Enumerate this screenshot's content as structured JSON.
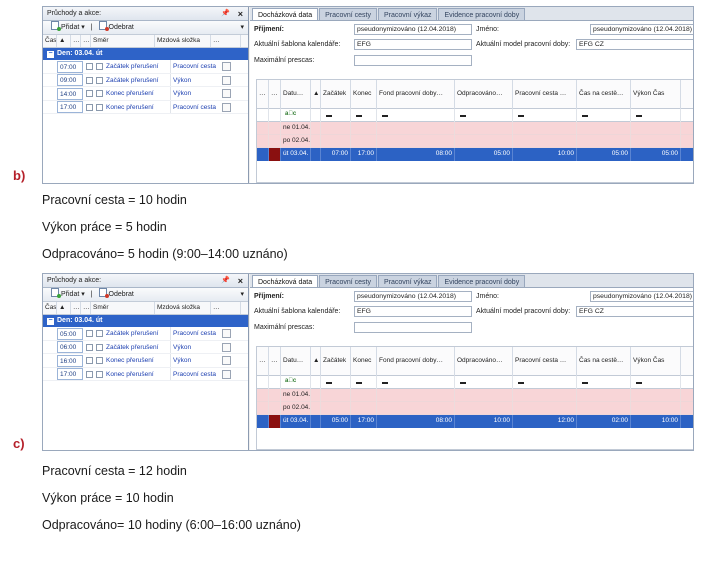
{
  "blocks": [
    {
      "marker": "b)",
      "left_panel": {
        "title": "Průchody a akce:",
        "pin": "📌",
        "close": "×",
        "add_label": "Přidat",
        "remove_label": "Odebrat",
        "headers": [
          "Čas",
          "▲",
          "…",
          "…",
          "Směr",
          "Mzdová složka",
          "…"
        ],
        "group_label": "Den: 03.04. út",
        "rows": [
          {
            "time": "07:00",
            "direction": "Začátek přerušení",
            "wage": "Pracovní cesta"
          },
          {
            "time": "09:00",
            "direction": "Začátek přerušení",
            "wage": "Výkon"
          },
          {
            "time": "14:00",
            "direction": "Konec přerušení",
            "wage": "Výkon"
          },
          {
            "time": "17:00",
            "direction": "Konec přerušení",
            "wage": "Pracovní cesta"
          }
        ]
      },
      "right_panel": {
        "tabs": [
          "Docházková data",
          "Pracovní cesty",
          "Pracovní výkaz",
          "Evidence pracovní doby"
        ],
        "surname_label": "Příjmení:",
        "surname_value": "pseudonymizováno (12.04.2018)",
        "name_label": "Jméno:",
        "name_value": "pseudonymizováno (12.04.2018)",
        "calendar_label": "Aktuální šablona kalendáře:",
        "calendar_value": "EFG",
        "model_label": "Aktuální model pracovní doby:",
        "model_value": "EFG CZ",
        "overtime_label": "Maximální prescas:",
        "grid_headers": [
          "…",
          "…",
          "Datu…",
          "▲",
          "Začátek",
          "Konec",
          "Fond pracovní doby…",
          "Odpracováno…",
          "Pracovní cesta …",
          "Čas na cestě…",
          "Výkon Čas"
        ],
        "filter_abc": "a⃞c",
        "rows": [
          {
            "date": "ne 01.04.",
            "start": "",
            "end": "",
            "fund": "",
            "worked": "",
            "trip": "",
            "travel": "",
            "perf": "",
            "kind": "pink"
          },
          {
            "date": "po 02.04.",
            "start": "",
            "end": "",
            "fund": "",
            "worked": "",
            "trip": "",
            "travel": "",
            "perf": "",
            "kind": "pink"
          },
          {
            "date": "út 03.04.",
            "start": "07:00",
            "end": "17:00",
            "fund": "08:00",
            "worked": "05:00",
            "trip": "10:00",
            "travel": "05:00",
            "perf": "05:00",
            "kind": "sel"
          }
        ]
      },
      "captions": [
        "Pracovní cesta = 10 hodin",
        "Výkon práce = 5 hodin",
        "Odpracováno= 5 hodin (9:00–14:00 uznáno)"
      ]
    },
    {
      "marker": "c)",
      "left_panel": {
        "title": "Průchody a akce:",
        "pin": "📌",
        "close": "×",
        "add_label": "Přidat",
        "remove_label": "Odebrat",
        "headers": [
          "Čas",
          "▲",
          "…",
          "…",
          "Směr",
          "Mzdová složka",
          "…"
        ],
        "group_label": "Den: 03.04. út",
        "rows": [
          {
            "time": "05:00",
            "direction": "Začátek přerušení",
            "wage": "Pracovní cesta"
          },
          {
            "time": "06:00",
            "direction": "Začátek přerušení",
            "wage": "Výkon"
          },
          {
            "time": "16:00",
            "direction": "Konec přerušení",
            "wage": "Výkon"
          },
          {
            "time": "17:00",
            "direction": "Konec přerušení",
            "wage": "Pracovní cesta"
          }
        ]
      },
      "right_panel": {
        "tabs": [
          "Docházková data",
          "Pracovní cesty",
          "Pracovní výkaz",
          "Evidence pracovní doby"
        ],
        "surname_label": "Příjmení:",
        "surname_value": "pseudonymizováno (12.04.2018)",
        "name_label": "Jméno:",
        "name_value": "pseudonymizováno (12.04.2018)",
        "calendar_label": "Aktuální šablona kalendáře:",
        "calendar_value": "EFG",
        "model_label": "Aktuální model pracovní doby:",
        "model_value": "EFG CZ",
        "overtime_label": "Maximální prescas:",
        "grid_headers": [
          "…",
          "…",
          "Datu…",
          "▲",
          "Začátek",
          "Konec",
          "Fond pracovní doby…",
          "Odpracováno…",
          "Pracovní cesta …",
          "Čas na cestě…",
          "Výkon Čas"
        ],
        "filter_abc": "a⃞c",
        "rows": [
          {
            "date": "ne 01.04.",
            "start": "",
            "end": "",
            "fund": "",
            "worked": "",
            "trip": "",
            "travel": "",
            "perf": "",
            "kind": "pink"
          },
          {
            "date": "po 02.04.",
            "start": "",
            "end": "",
            "fund": "",
            "worked": "",
            "trip": "",
            "travel": "",
            "perf": "",
            "kind": "pink"
          },
          {
            "date": "út 03.04.",
            "start": "05:00",
            "end": "17:00",
            "fund": "08:00",
            "worked": "10:00",
            "trip": "12:00",
            "travel": "02:00",
            "perf": "10:00",
            "kind": "sel"
          }
        ]
      },
      "captions": [
        "Pracovní cesta = 12 hodin",
        "Výkon práce = 10 hodin",
        "Odpracováno= 10 hodiny (6:00–16:00 uznáno)"
      ]
    }
  ]
}
